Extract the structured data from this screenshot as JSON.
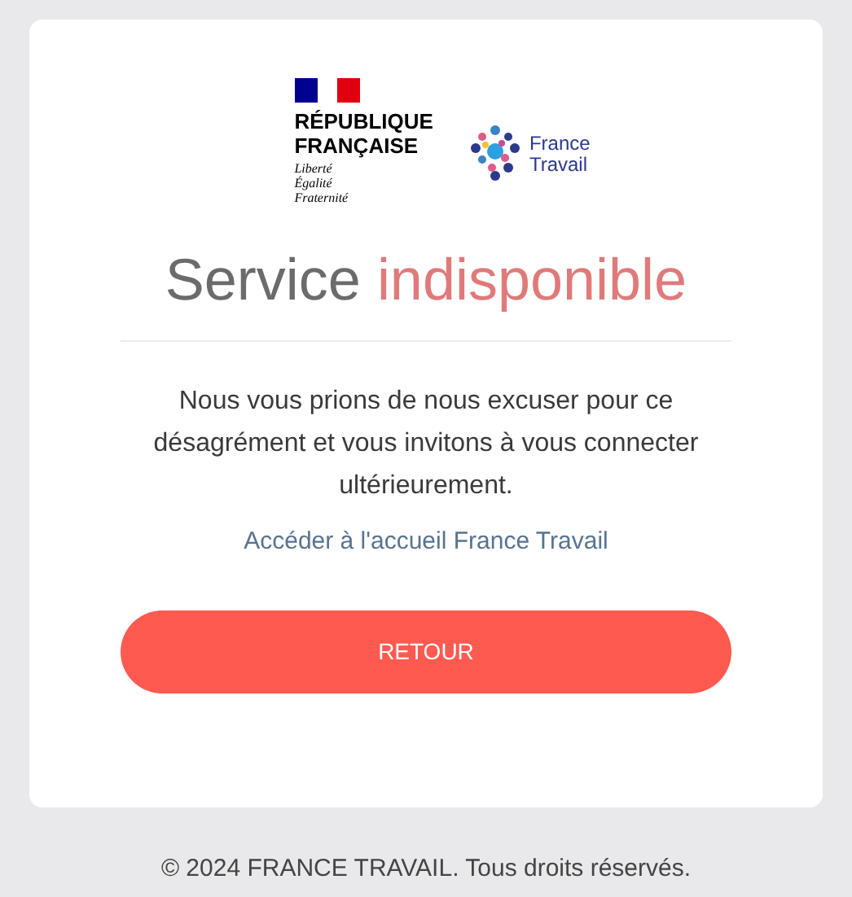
{
  "logos": {
    "republic": {
      "name_lines": [
        "RÉPUBLIQUE",
        "FRANÇAISE"
      ],
      "motto": [
        "Liberté",
        "Égalité",
        "Fraternité"
      ]
    },
    "agency": {
      "name_lines": [
        "France",
        "Travail"
      ]
    }
  },
  "title": {
    "lead": "Service",
    "accent": "indisponible"
  },
  "message": "Nous vous prions de nous excuser pour ce désagrément et vous invitons à vous connecter ultérieurement.",
  "link": "Accéder à l'accueil France Travail",
  "button": "RETOUR",
  "footer": "© 2024 FRANCE TRAVAIL. Tous droits réservés."
}
